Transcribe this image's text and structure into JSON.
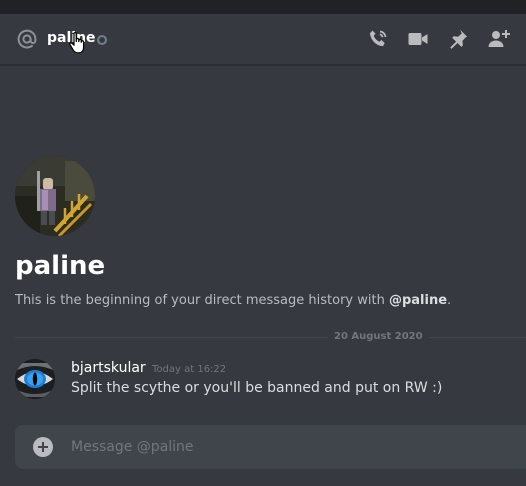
{
  "header": {
    "recipient": "paline",
    "status": "offline",
    "icons": [
      "at-icon",
      "call-icon",
      "video-icon",
      "pin-icon",
      "add-friend-icon"
    ]
  },
  "welcome": {
    "name": "paline",
    "intro_prefix": "This is the beginning of your direct message history with ",
    "intro_mention": "@paline",
    "intro_suffix": "."
  },
  "divider": {
    "date": "20 August 2020"
  },
  "messages": [
    {
      "author": "bjartskular",
      "timestamp": "Today at 16:22",
      "text": "Split the scythe or you'll be banned and put on RW :)"
    }
  ],
  "composer": {
    "placeholder": "Message @paline"
  },
  "colors": {
    "background": "#36393f",
    "topstrip": "#202225",
    "composer": "#40444b",
    "muted_text": "#72767d",
    "icon": "#b9bbbe",
    "status_offline": "#747f8d"
  }
}
